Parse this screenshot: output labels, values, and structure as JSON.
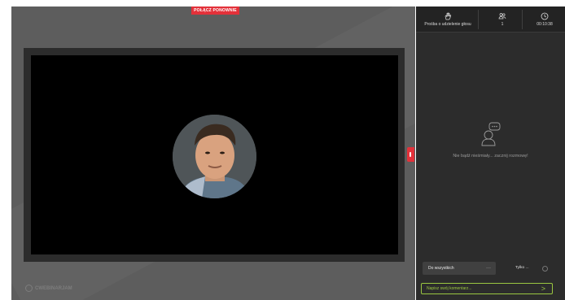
{
  "stage": {
    "reconnect_label": "POŁĄCZ PONOWNIE",
    "watermark_text": "CWEBINARJAM"
  },
  "topbar": {
    "raise_hand_label": "Prośba o udzielenie głosu",
    "attendee_count": "1",
    "timer": "00:10:38"
  },
  "chat": {
    "empty_message": "Nie bądź nieśmiały... zacznij rozmowę!",
    "audience_label": "Do wszystkich",
    "host_only_label": "Tylko ...",
    "comment_placeholder": "Napisz swój komentarz..."
  },
  "colors": {
    "accent_red": "#e3313a",
    "accent_green": "#9ac641",
    "panel_bg": "#2c2c2c"
  },
  "icons": [
    "hand-icon",
    "attendees-icon",
    "clock-icon",
    "chat-empty-icon",
    "send-icon",
    "more-icon"
  ]
}
